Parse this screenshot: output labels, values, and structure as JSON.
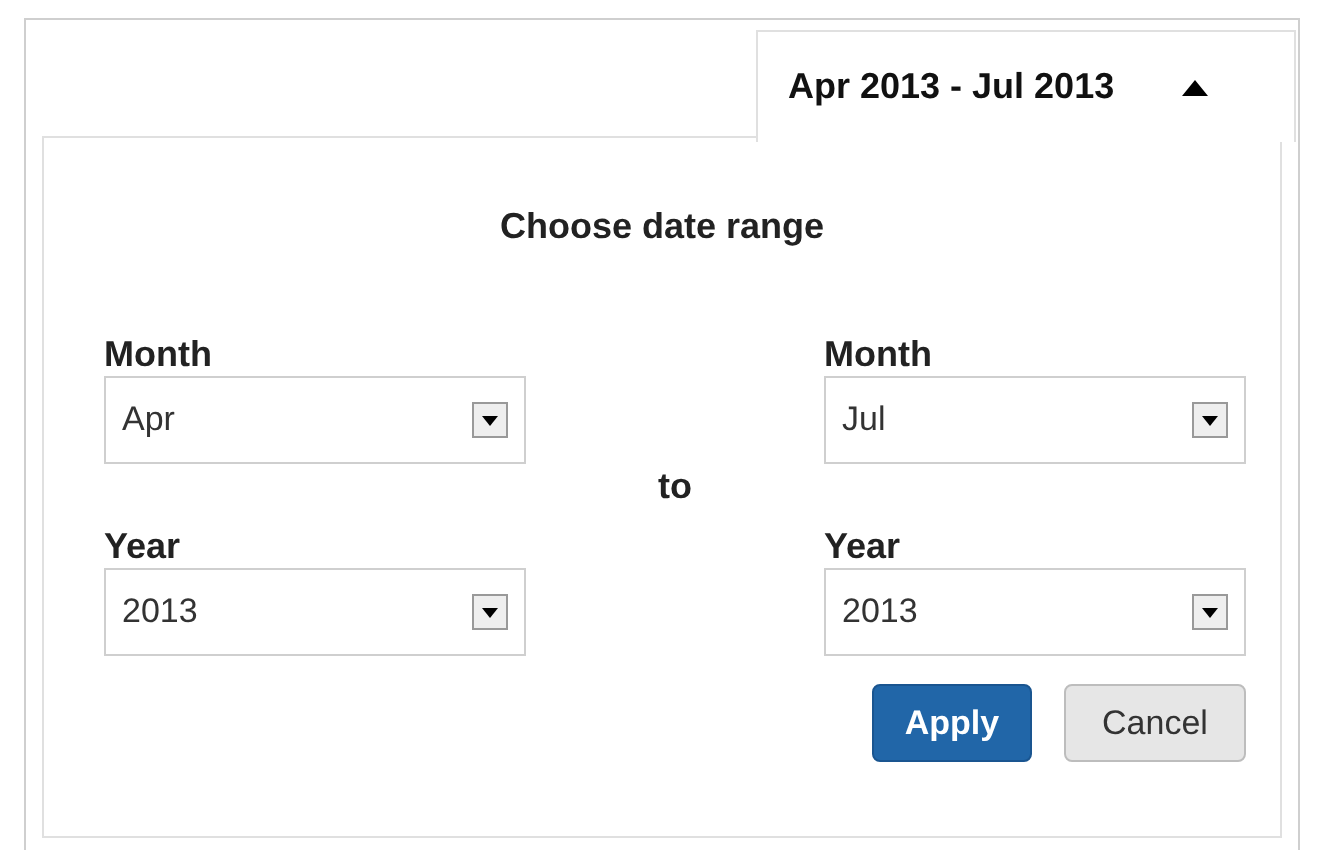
{
  "range_toggle": {
    "label": "Apr 2013 - Jul 2013",
    "expanded": true
  },
  "dialog": {
    "title": "Choose date range",
    "connector": "to",
    "from": {
      "month_label": "Month",
      "month": "Apr",
      "year_label": "Year",
      "year": "2013"
    },
    "until": {
      "month_label": "Month",
      "month": "Jul",
      "year_label": "Year",
      "year": "2013"
    },
    "buttons": [
      {
        "label": "Apply",
        "kind": "primary"
      },
      {
        "label": "Cancel",
        "kind": "secondary"
      }
    ]
  }
}
